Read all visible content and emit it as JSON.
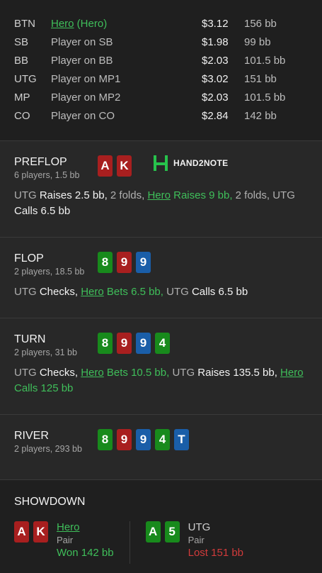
{
  "players": [
    {
      "pos": "BTN",
      "name": "Hero (Hero)",
      "hero": true,
      "stack": "$3.12",
      "bb": "156 bb"
    },
    {
      "pos": "SB",
      "name": "Player on SB",
      "hero": false,
      "stack": "$1.98",
      "bb": "99 bb"
    },
    {
      "pos": "BB",
      "name": "Player on BB",
      "hero": false,
      "stack": "$2.03",
      "bb": "101.5 bb"
    },
    {
      "pos": "UTG",
      "name": "Player on MP1",
      "hero": false,
      "stack": "$3.02",
      "bb": "151 bb"
    },
    {
      "pos": "MP",
      "name": "Player on MP2",
      "hero": false,
      "stack": "$2.03",
      "bb": "101.5 bb"
    },
    {
      "pos": "CO",
      "name": "Player on CO",
      "hero": false,
      "stack": "$2.84",
      "bb": "142 bb"
    }
  ],
  "logo_text": "HAND2NOTE",
  "streets": [
    {
      "title": "PREFLOP",
      "sub": "6 players, 1.5 bb",
      "cards": [
        {
          "v": "A",
          "c": "red"
        },
        {
          "v": "K",
          "c": "red"
        }
      ],
      "action": [
        {
          "t": "UTG ",
          "s": ""
        },
        {
          "t": "Raises 2.5 bb,",
          "s": "w"
        },
        {
          "t": " 2 folds, ",
          "s": ""
        },
        {
          "t": "Hero",
          "s": "g u"
        },
        {
          "t": " Raises 9 bb,",
          "s": "g"
        },
        {
          "t": " 2 folds, UTG ",
          "s": ""
        },
        {
          "t": "Calls 6.5 bb",
          "s": "w"
        }
      ]
    },
    {
      "title": "FLOP",
      "sub": "2 players, 18.5 bb",
      "cards": [
        {
          "v": "8",
          "c": "green"
        },
        {
          "v": "9",
          "c": "red"
        },
        {
          "v": "9",
          "c": "blue"
        }
      ],
      "action": [
        {
          "t": "UTG ",
          "s": ""
        },
        {
          "t": "Checks, ",
          "s": "w"
        },
        {
          "t": "Hero",
          "s": "g u"
        },
        {
          "t": " Bets 6.5 bb,",
          "s": "g"
        },
        {
          "t": " UTG ",
          "s": ""
        },
        {
          "t": "Calls 6.5 bb",
          "s": "w"
        }
      ]
    },
    {
      "title": "TURN",
      "sub": "2 players, 31 bb",
      "cards": [
        {
          "v": "8",
          "c": "green"
        },
        {
          "v": "9",
          "c": "red"
        },
        {
          "v": "9",
          "c": "blue"
        },
        {
          "v": "4",
          "c": "green"
        }
      ],
      "action": [
        {
          "t": "UTG ",
          "s": ""
        },
        {
          "t": "Checks, ",
          "s": "w"
        },
        {
          "t": "Hero",
          "s": "g u"
        },
        {
          "t": " Bets 10.5 bb,",
          "s": "g"
        },
        {
          "t": " UTG ",
          "s": ""
        },
        {
          "t": "Raises 135.5 bb,",
          "s": "w"
        },
        {
          "t": " ",
          "s": ""
        },
        {
          "t": "Hero",
          "s": "g u"
        },
        {
          "t": " Calls 125 bb",
          "s": "g"
        }
      ]
    },
    {
      "title": "RIVER",
      "sub": "2 players, 293 bb",
      "cards": [
        {
          "v": "8",
          "c": "green"
        },
        {
          "v": "9",
          "c": "red"
        },
        {
          "v": "9",
          "c": "blue"
        },
        {
          "v": "4",
          "c": "green"
        },
        {
          "v": "T",
          "c": "blue"
        }
      ],
      "action": []
    }
  ],
  "showdown": {
    "title": "SHOWDOWN",
    "players": [
      {
        "name": "Hero",
        "hand": "Pair",
        "result": "Won 142 bb",
        "win": true,
        "cards": [
          {
            "v": "A",
            "c": "red"
          },
          {
            "v": "K",
            "c": "red"
          }
        ]
      },
      {
        "name": "UTG",
        "hand": "Pair",
        "result": "Lost 151 bb",
        "win": false,
        "cards": [
          {
            "v": "A",
            "c": "green"
          },
          {
            "v": "5",
            "c": "green"
          }
        ]
      }
    ]
  },
  "colors": {
    "green_text": "#3fbf5a",
    "red_text": "#d13b3b",
    "card_red": "#a81f1f",
    "card_green": "#188a1c",
    "card_blue": "#1a5ea8"
  }
}
